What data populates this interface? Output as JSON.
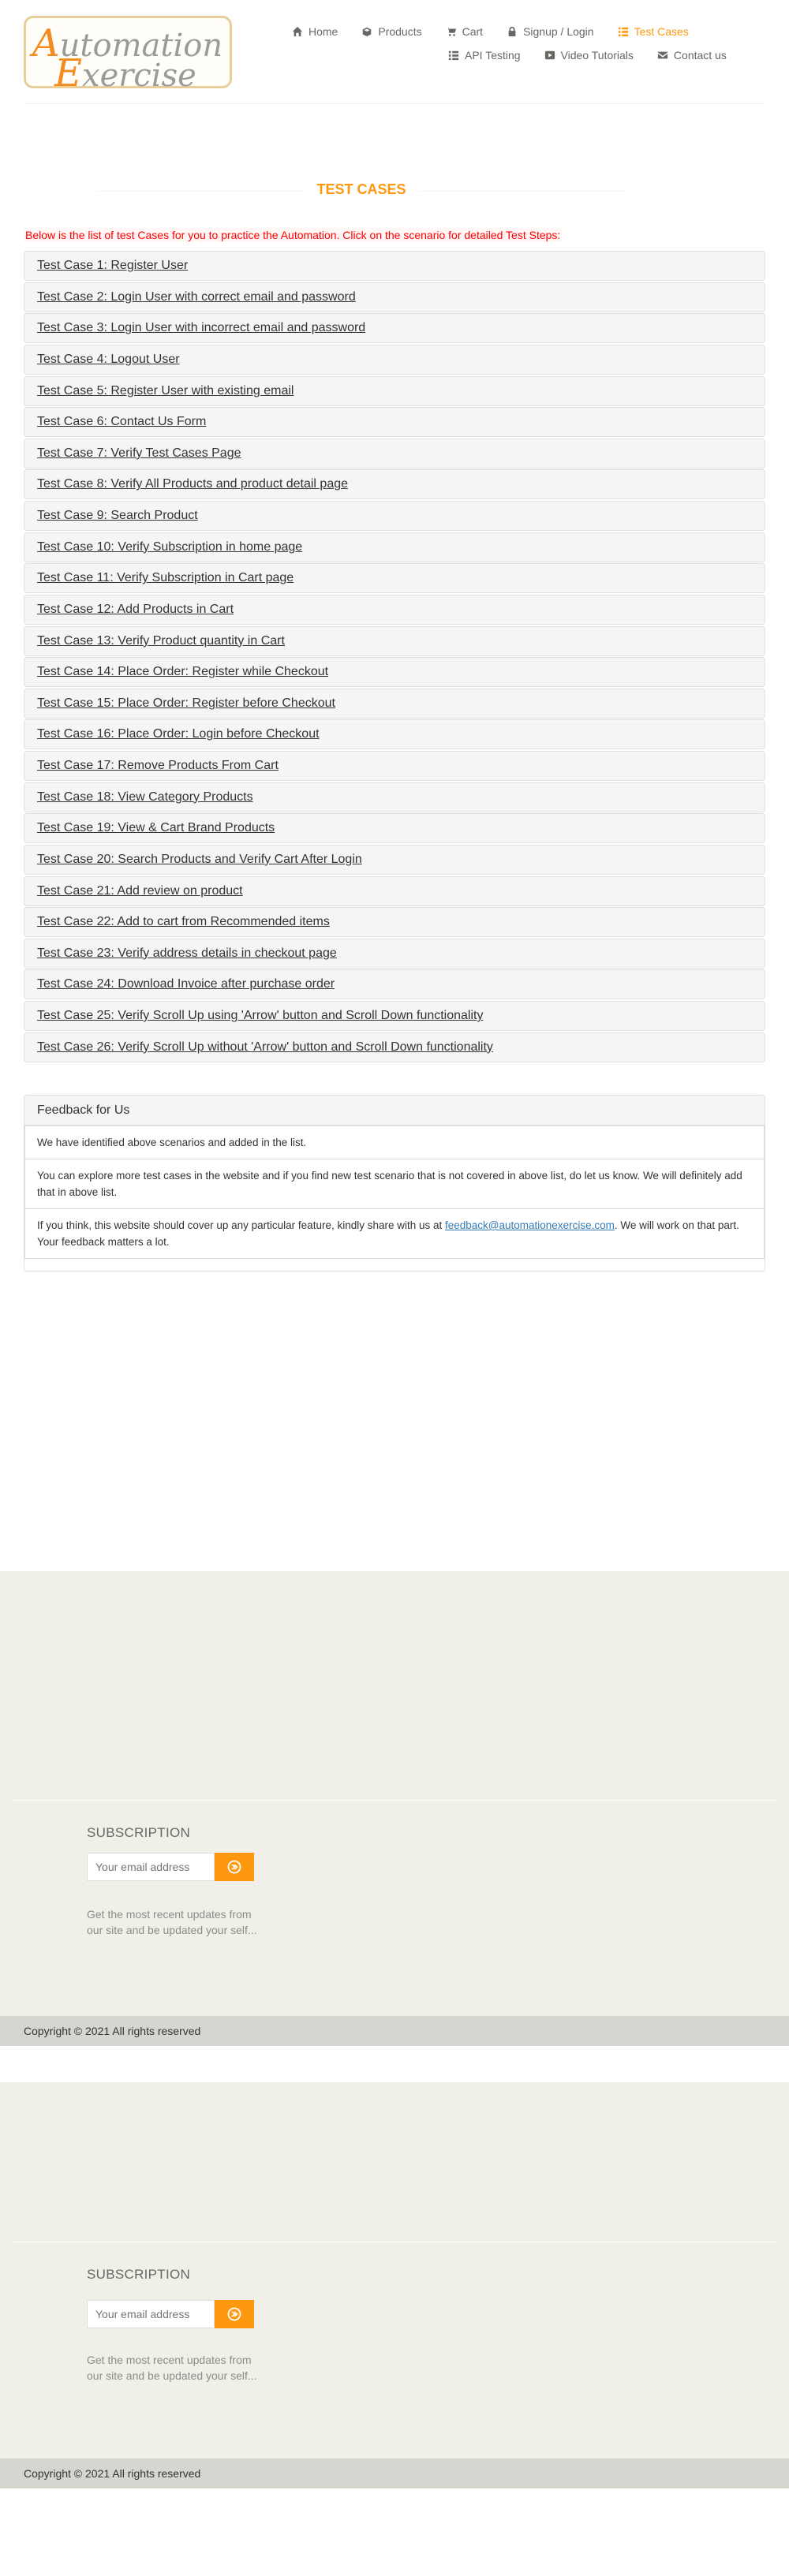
{
  "brand": {
    "logo_word1_cap": "A",
    "logo_word1_rest": "utomation",
    "logo_word2_cap": "E",
    "logo_word2_rest": "xercise",
    "accent_color": "#fe980f"
  },
  "nav": {
    "items": [
      {
        "label": "Home",
        "icon": "home-icon"
      },
      {
        "label": "Products",
        "icon": "products-icon"
      },
      {
        "label": "Cart",
        "icon": "cart-icon"
      },
      {
        "label": "Signup / Login",
        "icon": "lock-icon"
      },
      {
        "label": "Test Cases",
        "icon": "list-icon",
        "active": true
      },
      {
        "label": "API Testing",
        "icon": "list-icon"
      },
      {
        "label": "Video Tutorials",
        "icon": "youtube-icon"
      },
      {
        "label": "Contact us",
        "icon": "envelope-icon"
      }
    ]
  },
  "page": {
    "title": "TEST CASES",
    "intro": "Below is the list of test Cases for you to practice the Automation. Click on the scenario for detailed Test Steps:"
  },
  "test_cases": [
    "Test Case 1: Register User",
    "Test Case 2: Login User with correct email and password",
    "Test Case 3: Login User with incorrect email and password",
    "Test Case 4: Logout User",
    "Test Case 5: Register User with existing email",
    "Test Case 6: Contact Us Form",
    "Test Case 7: Verify Test Cases Page",
    "Test Case 8: Verify All Products and product detail page",
    "Test Case 9: Search Product",
    "Test Case 10: Verify Subscription in home page",
    "Test Case 11: Verify Subscription in Cart page",
    "Test Case 12: Add Products in Cart",
    "Test Case 13: Verify Product quantity in Cart",
    "Test Case 14: Place Order: Register while Checkout",
    "Test Case 15: Place Order: Register before Checkout",
    "Test Case 16: Place Order: Login before Checkout",
    "Test Case 17: Remove Products From Cart",
    "Test Case 18: View Category Products",
    "Test Case 19: View & Cart Brand Products",
    "Test Case 20: Search Products and Verify Cart After Login",
    "Test Case 21: Add review on product",
    "Test Case 22: Add to cart from Recommended items",
    "Test Case 23: Verify address details in checkout page",
    "Test Case 24: Download Invoice after purchase order",
    "Test Case 25: Verify Scroll Up using 'Arrow' button and Scroll Down functionality",
    "Test Case 26: Verify Scroll Up without 'Arrow' button and Scroll Down functionality"
  ],
  "feedback": {
    "title": "Feedback for Us",
    "p1": "We have identified above scenarios and added in the list.",
    "p2": "You can explore more test cases in the website and if you find new test scenario that is not covered in above list, do let us know. We will definitely add that in above list.",
    "p3_before": "If you think, this website should cover up any particular feature, kindly share with us at ",
    "p3_email": "feedback@automationexercise.com",
    "p3_after": ". We will work on that part. Your feedback matters a lot."
  },
  "footer": {
    "subscription_title": "SUBSCRIPTION",
    "email_placeholder": "Your email address",
    "subscribe_text": "Get the most recent updates from our site and be updated your self...",
    "copyright": "Copyright © 2021 All rights reserved"
  }
}
